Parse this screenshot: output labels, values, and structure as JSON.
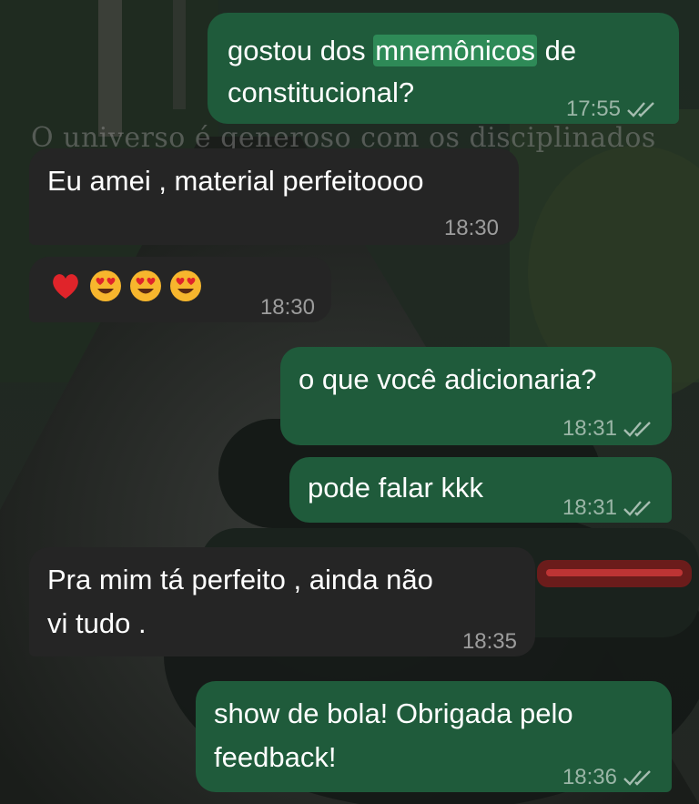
{
  "wallpaper": {
    "caption": "O universo é generoso com os disciplinados"
  },
  "messages": [
    {
      "direction": "out",
      "text_before": "gostou dos ",
      "highlight": "mnemônicos",
      "text_after": " de",
      "line2": "constitucional?",
      "time": "17:55"
    },
    {
      "direction": "in",
      "text": "Eu amei , material perfeitoooo",
      "time": "18:30"
    },
    {
      "direction": "in",
      "emojis": [
        "red-heart",
        "heart-eyes",
        "heart-eyes",
        "heart-eyes"
      ],
      "time": "18:30"
    },
    {
      "direction": "out",
      "text": "o que você adicionaria?",
      "time": "18:31"
    },
    {
      "direction": "out",
      "text": "pode falar kkk",
      "time": "18:31"
    },
    {
      "direction": "in",
      "line1": "Pra mim tá perfeito , ainda não",
      "line2": "vi tudo .",
      "time": "18:35"
    },
    {
      "direction": "out",
      "line1": "show de bola! Obrigada pelo",
      "line2": "feedback!",
      "time": "18:36"
    }
  ],
  "colors": {
    "outgoing": "#1f5b3b",
    "incoming": "#252525",
    "highlight": "#2e8a57"
  }
}
